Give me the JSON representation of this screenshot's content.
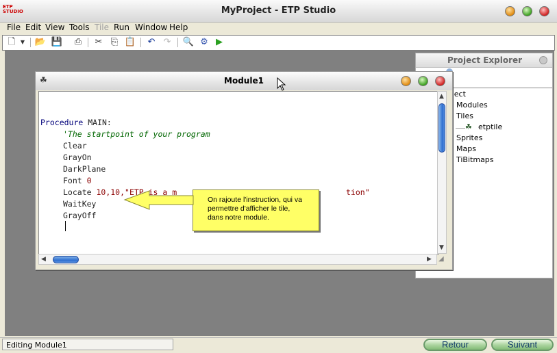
{
  "app": {
    "logo_text": "ETP STUDIO",
    "title": "MyProject - ETP Studio"
  },
  "menu": [
    "File",
    "Edit",
    "View",
    "Tools",
    "Tile",
    "Run",
    "Window",
    "Help"
  ],
  "menu_disabled": [
    "Tile"
  ],
  "explorer": {
    "title": "Project Explorer",
    "items": [
      "oject",
      "Modules",
      "Tiles",
      "etptile",
      "Sprites",
      "Maps",
      "TiBitmaps"
    ]
  },
  "module": {
    "title": "Module1",
    "code": {
      "l1_kw": "Procedure",
      "l1_rest": " MAIN:",
      "l2": "'The startpoint of your program",
      "l3": "Clear",
      "l4": "GrayOn",
      "l5": "DarkPlane",
      "l6_a": "Font ",
      "l6_b": "0",
      "l7_a": "Locate ",
      "l7_b": "10,10,",
      "l7_c": "\"ETP is a m",
      "l7_d": "tion\"",
      "l8": "WaitKey",
      "l9": "GrayOff"
    }
  },
  "callout": {
    "line1": "On rajoute l'instruction, qui va",
    "line2": "permettre d'afficher le tile,",
    "line3": "dans notre module."
  },
  "status": {
    "text": "Editing Module1"
  },
  "nav": {
    "back": "Retour",
    "next": "Suivant"
  },
  "colors": {
    "callout_bg": "#FFFF66",
    "keyword": "#00007A",
    "comment": "#006600",
    "string": "#8B0000",
    "scroll_thumb": "#2F6FD0"
  }
}
